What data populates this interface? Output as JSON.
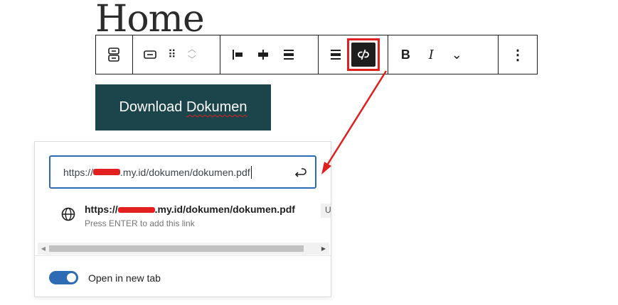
{
  "page": {
    "title": "Home"
  },
  "toolbar": {
    "up_glyph": "︿",
    "down_glyph": "﹀",
    "drag_glyph": "⠿",
    "bold_label": "B",
    "italic_label": "I",
    "more_formats_glyph": "⌄",
    "options_glyph": "⋮"
  },
  "button_block": {
    "text_before": "Download ",
    "text_misspelled": "Dokumen"
  },
  "link_popover": {
    "input": {
      "prefix": "https://",
      "suffix": ".my.id/dokumen/dokumen.pdf"
    },
    "suggestion": {
      "prefix": "https://",
      "suffix": ".my.id/dokumen/dokumen.pdf",
      "hint": "Press ENTER to add this link",
      "tag": "U"
    },
    "scroll": {
      "left_arrow": "◀",
      "right_arrow": "▶"
    },
    "new_tab": {
      "label": "Open in new tab",
      "enabled": true
    }
  },
  "colors": {
    "accent": "#2e6bb5",
    "button_bg": "#1b454a",
    "annotation": "#e0201e",
    "toolbar_active": "#1e1e1e"
  }
}
